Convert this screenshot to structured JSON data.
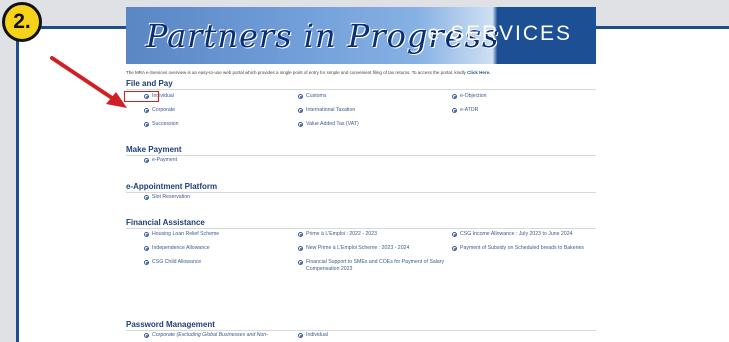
{
  "badge": "2.",
  "banner": {
    "script_title": "Partners in Progress",
    "service_title": "e-SERVICES"
  },
  "intro": {
    "text": "The MRA e-Services overview is an easy-to-use web portal which provides a single point of entry for simple and convenient filing of tax returns. To access the portal, kindly ",
    "link": "Click Here."
  },
  "sections": {
    "file_pay": {
      "title": "File and Pay",
      "items": [
        "Individual",
        "Corporate",
        "Succession",
        "Customs",
        "International Taxation",
        "Value Added Tax (VAT)",
        "e-Objection",
        "e-ATDR"
      ]
    },
    "make_payment": {
      "title": "Make Payment",
      "items": [
        "e-Payment"
      ]
    },
    "appointment": {
      "title": "e-Appointment Platform",
      "items": [
        "Slot Reservation"
      ]
    },
    "financial": {
      "title": "Financial Assistance",
      "items": [
        "Housing Loan Relief Scheme",
        "Independence Allowance",
        "CSG Child Allowance",
        "Prime à L'Emploi : 2022 - 2023",
        "New Prime à L'Emploi Scheme : 2023 - 2024",
        "Financial Support to SMEs and COEs for Payment of Salary Compensation 2023",
        "CSG Income Allowance : July 2023 to June 2024",
        "Payment of Subsidy on Scheduled breads to Bakeries"
      ]
    },
    "password": {
      "title": "Password Management",
      "items": [
        "Corporate (Excluding Global Businesses and Non-",
        "Individual"
      ]
    }
  },
  "colors": {
    "highlight": "#d11f26",
    "arrow": "#d11f26",
    "badge": "#f7d21a",
    "accent": "#1d4f95"
  }
}
